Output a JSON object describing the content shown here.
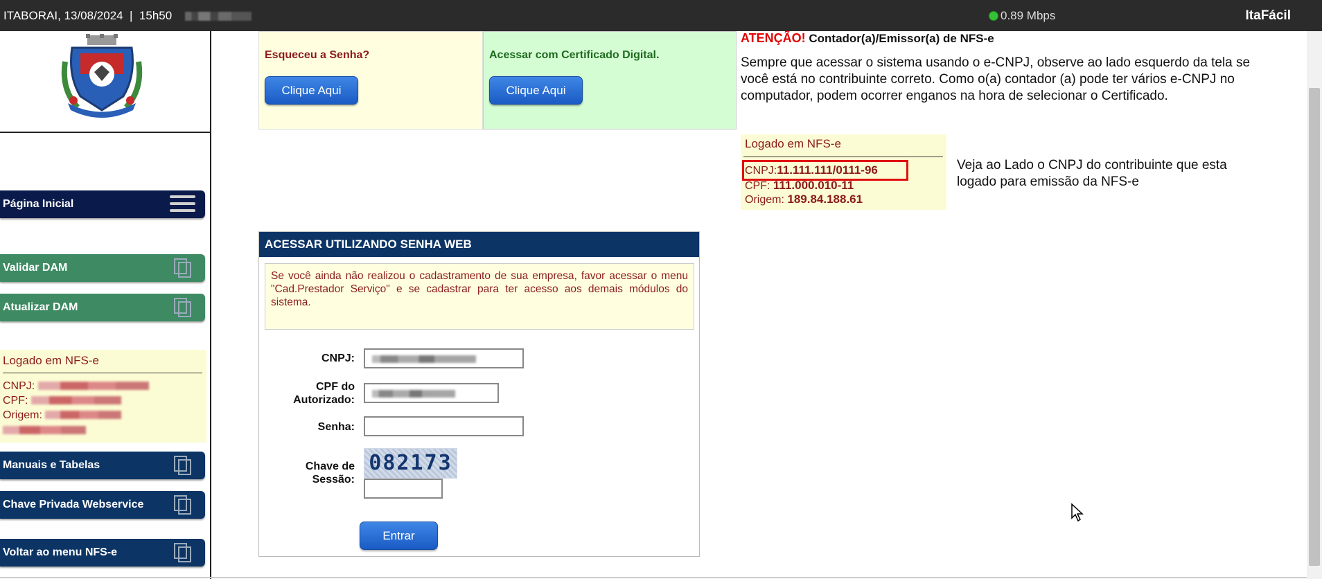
{
  "topbar": {
    "location_datetime": "ITABORAI, 13/08/2024  |  15h50",
    "speed": "0.89 Mbps",
    "brand": "ItaFácil"
  },
  "sidebar": {
    "home": "Página Inicial",
    "validar_dam": "Validar DAM",
    "atualizar_dam": "Atualizar DAM",
    "logged_title": "Logado em NFS-e",
    "cnpj_label": "CNPJ:",
    "cpf_label": "CPF:",
    "origem_label": "Origem:",
    "manuais": "Manuais e Tabelas",
    "chave_privada": "Chave Privada Webservice",
    "voltar": "Voltar ao menu NFS-e"
  },
  "panels": {
    "forgot_label": "Esqueceu a Senha?",
    "forgot_button": "Clique Aqui",
    "cert_label": "Acessar com Certificado Digital.",
    "cert_button": "Clique Aqui"
  },
  "attention": {
    "prefix": "ATENÇÃO!",
    "title": " Contador(a)/Emissor(a) de NFS-e",
    "body": "Sempre que acessar o sistema usando o e-CNPJ, observe ao lado esquerdo da tela se você está no contribuinte correto. Como o(a) contador (a) pode ter vários e-CNPJ no computador, podem ocorrer enganos na hora de selecionar o Certificado."
  },
  "example": {
    "title": "Logado em NFS-e",
    "cnpj_label": "CNPJ:",
    "cnpj_value": "11.111.111/0111-96",
    "cpf_label": "CPF:",
    "cpf_value": "111.000.010-11",
    "origem_label": "Origem:",
    "origem_value": "189.84.188.61",
    "note": "Veja ao Lado o CNPJ do contribuinte que esta logado para emissão da NFS-e"
  },
  "form": {
    "header": "ACESSAR UTILIZANDO SENHA WEB",
    "notice": "Se você ainda não realizou o cadastramento de sua empresa, favor acessar o menu \"Cad.Prestador Serviço\" e se cadastrar para ter acesso aos demais módulos do sistema.",
    "cnpj_label": "CNPJ:",
    "cpf_label": "CPF do Autorizado:",
    "senha_label": "Senha:",
    "chave_label": "Chave de Sessão:",
    "captcha": "082173",
    "submit": "Entrar"
  }
}
